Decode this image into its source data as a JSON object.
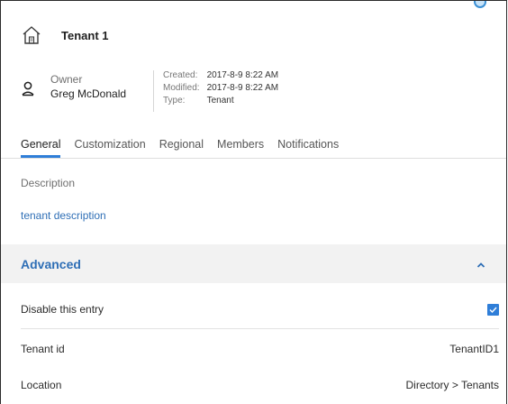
{
  "header": {
    "title": "Tenant 1",
    "owner_label": "Owner",
    "owner_name": "Greg McDonald",
    "meta": {
      "created_label": "Created:",
      "created_value": "2017-8-9 8:22 AM",
      "modified_label": "Modified:",
      "modified_value": "2017-8-9 8:22 AM",
      "type_label": "Type:",
      "type_value": "Tenant"
    }
  },
  "tabs": [
    {
      "label": "General",
      "active": true
    },
    {
      "label": "Customization",
      "active": false
    },
    {
      "label": "Regional",
      "active": false
    },
    {
      "label": "Members",
      "active": false
    },
    {
      "label": "Notifications",
      "active": false
    }
  ],
  "general": {
    "description_label": "Description",
    "description_value": "tenant description"
  },
  "advanced": {
    "title": "Advanced",
    "expanded": true,
    "disable_label": "Disable this entry",
    "disable_checked": true,
    "tenant_id_label": "Tenant id",
    "tenant_id_value": "TenantID1",
    "location_label": "Location",
    "location_value": "Directory > Tenants"
  },
  "colors": {
    "accent": "#2f7ed8",
    "link": "#2f6fb6",
    "section_bg": "#f2f2f2"
  },
  "icons": {
    "tenant": "house-icon",
    "owner": "user-icon",
    "collapse": "chevron-up-icon",
    "checkbox": "checkmark-icon"
  }
}
